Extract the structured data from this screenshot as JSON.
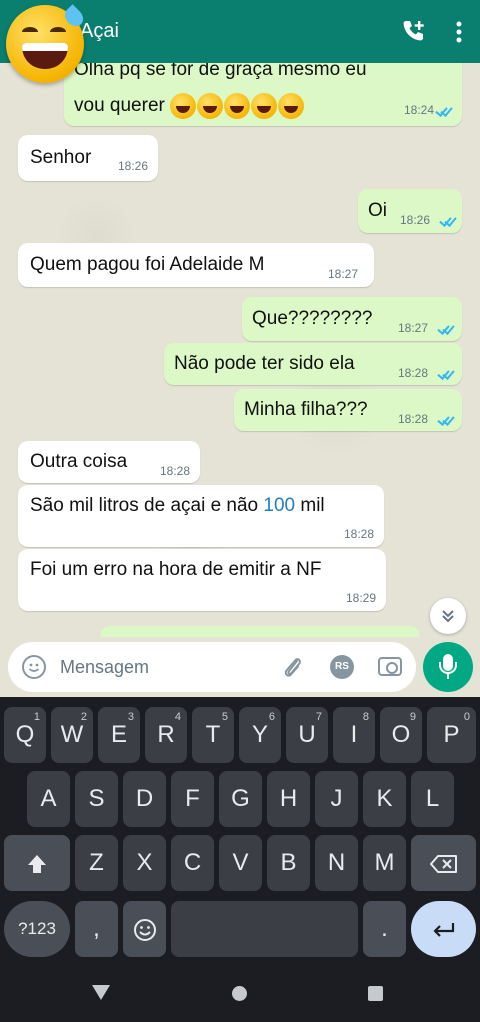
{
  "header": {
    "contact_name": "Açai"
  },
  "messages": [
    {
      "line1": "Olha pq se for de graça mesmo eu",
      "line2": "vou querer",
      "time": "18:24",
      "emoji": "😂"
    },
    {
      "text": "Senhor",
      "time": "18:26"
    },
    {
      "text": "Oi",
      "time": "18:26"
    },
    {
      "text": "Quem pagou foi Adelaide M",
      "time": "18:27"
    },
    {
      "text": "Que????????",
      "time": "18:27"
    },
    {
      "text": "Não pode ter sido ela",
      "time": "18:28"
    },
    {
      "text": "Minha filha???",
      "time": "18:28"
    },
    {
      "text": "Outra coisa",
      "time": "18:28"
    },
    {
      "text_before": "São mil litros de açai e não ",
      "number": "100",
      "text_after": " mil",
      "time": "18:28"
    },
    {
      "text": "Foi um erro na hora de emitir a NF",
      "time": "18:29"
    }
  ],
  "input": {
    "placeholder": "Mensagem",
    "rs_label": "RS"
  },
  "keyboard": {
    "row1": [
      {
        "k": "Q",
        "h": "1"
      },
      {
        "k": "W",
        "h": "2"
      },
      {
        "k": "E",
        "h": "3"
      },
      {
        "k": "R",
        "h": "4"
      },
      {
        "k": "T",
        "h": "5"
      },
      {
        "k": "Y",
        "h": "6"
      },
      {
        "k": "U",
        "h": "7"
      },
      {
        "k": "I",
        "h": "8"
      },
      {
        "k": "O",
        "h": "9"
      },
      {
        "k": "P",
        "h": "0"
      }
    ],
    "row2": [
      "A",
      "S",
      "D",
      "F",
      "G",
      "H",
      "J",
      "K",
      "L"
    ],
    "row3": [
      "Z",
      "X",
      "C",
      "V",
      "B",
      "N",
      "M"
    ],
    "symbols_label": "?123",
    "comma_label": ",",
    "period_label": "."
  },
  "colors": {
    "header": "#0a7f6f",
    "outgoing_bubble": "#dcf8c6",
    "incoming_bubble": "#ffffff",
    "read_ticks": "#34b7f1",
    "mic_button": "#00a884",
    "keyboard_bg": "#1b1d22"
  }
}
